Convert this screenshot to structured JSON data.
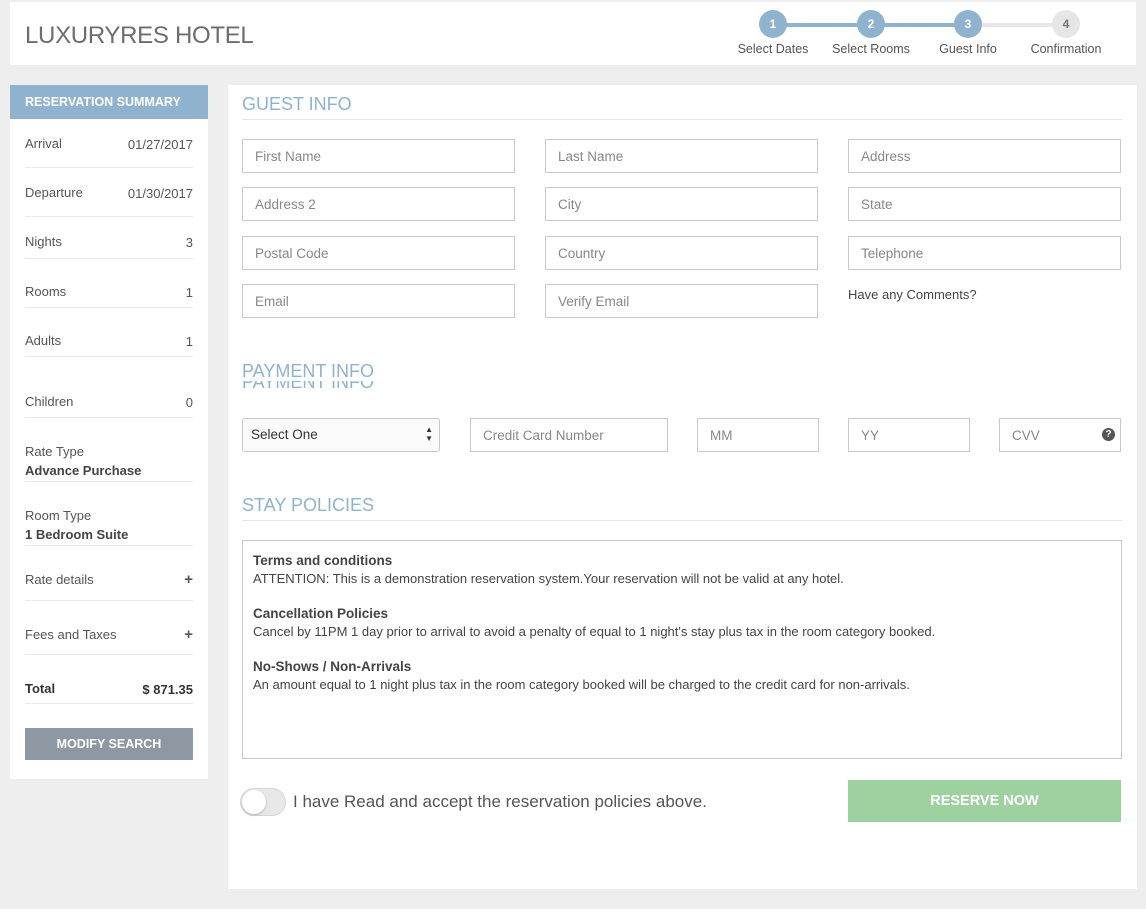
{
  "header": {
    "brand": "LUXURYRES HOTEL",
    "steps": [
      {
        "num": "1",
        "label": "Select Dates",
        "active": true
      },
      {
        "num": "2",
        "label": "Select Rooms",
        "active": true
      },
      {
        "num": "3",
        "label": "Guest Info",
        "active": true
      },
      {
        "num": "4",
        "label": "Confirmation",
        "active": false
      }
    ]
  },
  "summary": {
    "title": "RESERVATION SUMMARY",
    "arrival_label": "Arrival",
    "arrival": "01/27/2017",
    "departure_label": "Departure",
    "departure": "01/30/2017",
    "nights_label": "Nights",
    "nights": "3",
    "rooms_label": "Rooms",
    "rooms": "1",
    "adults_label": "Adults",
    "adults": "1",
    "children_label": "Children",
    "children": "0",
    "rate_type_label": "Rate Type",
    "rate_type": "Advance Purchase",
    "room_type_label": "Room Type",
    "room_type": "1 Bedroom Suite",
    "rate_details_label": "Rate details",
    "fees_label": "Fees and Taxes",
    "expand_glyph": "+",
    "total_label": "Total",
    "total": "$ 871.35",
    "modify_button": "MODIFY SEARCH"
  },
  "guest": {
    "title": "GUEST INFO",
    "first_name": "First Name",
    "last_name": "Last Name",
    "address": "Address",
    "address2": "Address 2",
    "city": "City",
    "state": "State",
    "postal": "Postal Code",
    "country": "Country",
    "telephone": "Telephone",
    "email": "Email",
    "verify_email": "Verify Email",
    "comments": "Have any Comments?"
  },
  "payment": {
    "title": "PAYMENT INFO",
    "card_type": "Select One",
    "card_number": "Credit Card Number",
    "mm": "MM",
    "yy": "YY",
    "cvv": "CVV",
    "help": "?"
  },
  "policies": {
    "title": "STAY POLICIES",
    "items": [
      {
        "heading": "Terms and conditions",
        "text": "ATTENTION: This is a demonstration reservation system.Your reservation will not be valid at any hotel."
      },
      {
        "heading": "Cancellation Policies",
        "text": "Cancel by 11PM 1 day prior to arrival to avoid a penalty of equal to 1 night's stay plus tax in the room category booked."
      },
      {
        "heading": "No-Shows / Non-Arrivals",
        "text": "An amount equal to 1 night plus tax in the room category booked will be charged to the credit card for non-arrivals."
      }
    ],
    "accept_text": "I have Read and accept the reservation policies above.",
    "reserve_button": "RESERVE NOW"
  },
  "colors": {
    "accent": "#8fb3cf",
    "reserve": "#9fd1a0",
    "modify": "#8e98a3"
  }
}
